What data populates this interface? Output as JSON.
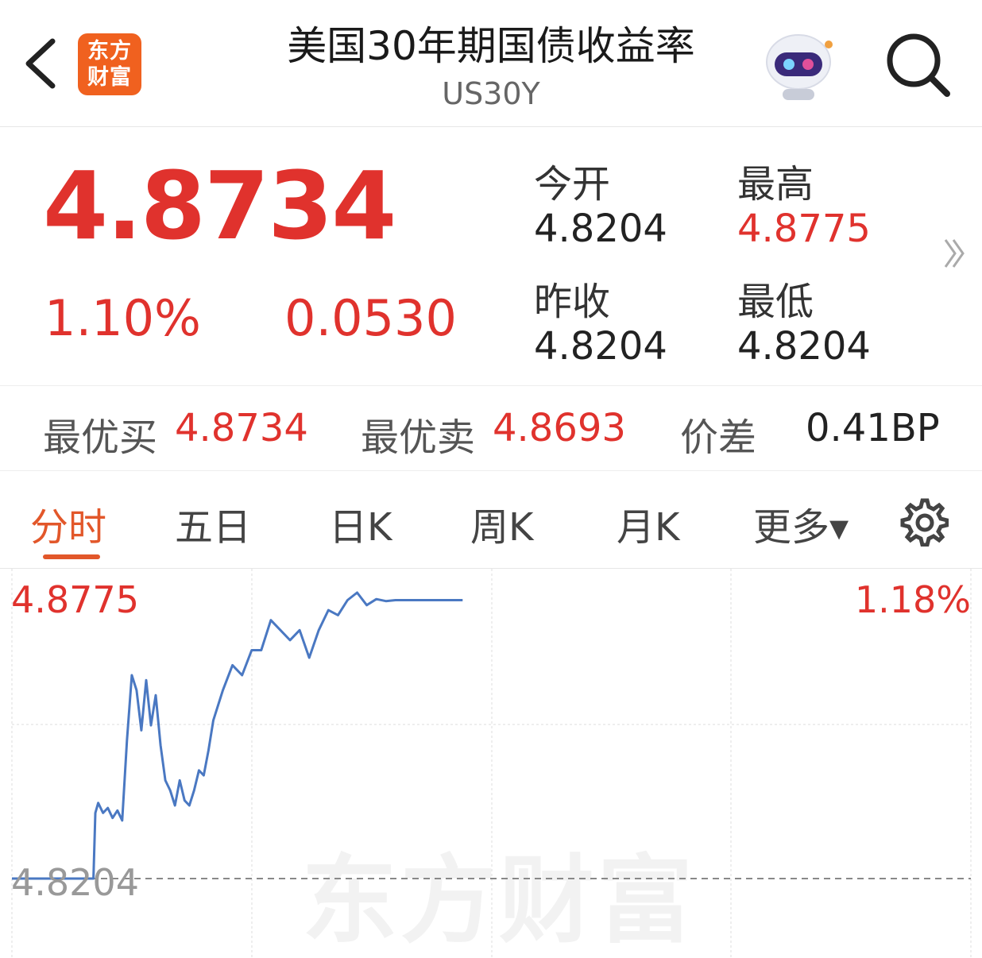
{
  "header": {
    "logo_line1": "东方",
    "logo_line2": "财富",
    "title": "美国30年期国债收益率",
    "subtitle": "US30Y",
    "icons": [
      "back-icon",
      "robot-avatar-icon",
      "search-icon"
    ]
  },
  "quote": {
    "price": "4.8734",
    "change_pct": "1.10%",
    "change": "0.0530",
    "open_label": "今开",
    "open_value": "4.8204",
    "high_label": "最高",
    "high_value": "4.8775",
    "prev_close_label": "昨收",
    "prev_close_value": "4.8204",
    "low_label": "最低",
    "low_value": "4.8204",
    "more_icon": "double-chevron-right-icon"
  },
  "bidask": {
    "bid_label": "最优买",
    "bid_value": "4.8734",
    "ask_label": "最优卖",
    "ask_value": "4.8693",
    "spread_label": "价差",
    "spread_value": "0.41BP"
  },
  "tabs": {
    "items": [
      "分时",
      "五日",
      "日K",
      "周K",
      "月K",
      "更多▾"
    ],
    "active": "分时",
    "settings_icon": "gear-icon"
  },
  "colors": {
    "up": "#e0322d",
    "accent": "#e2572a",
    "line": "#4a78c2"
  },
  "chart_data": {
    "type": "line",
    "top_left_label": "4.8775",
    "top_right_label": "1.18%",
    "base_label": "4.8204",
    "watermark": "东方财富",
    "y_range": [
      4.8204,
      4.8775
    ],
    "x_domain": [
      0,
      100
    ],
    "base_value": 4.8204,
    "grid": true,
    "series": [
      {
        "x": [
          0,
          3,
          8.5,
          8.7,
          9,
          9.5,
          10,
          10.5,
          11,
          11.5,
          12,
          12.5,
          13,
          13.5,
          14,
          14.5,
          15,
          15.5,
          16,
          16.5,
          17,
          17.5,
          18,
          18.5,
          19,
          19.5,
          20,
          20.5,
          21,
          22,
          23,
          24,
          25,
          26,
          27,
          28,
          29,
          30,
          31,
          32,
          33,
          34,
          35,
          36,
          37,
          38,
          39,
          40,
          41,
          42,
          43,
          44,
          45,
          46,
          47
        ],
        "y": [
          4.8204,
          4.8204,
          4.8204,
          4.8335,
          4.8355,
          4.8335,
          4.8345,
          4.8325,
          4.834,
          4.832,
          4.848,
          4.861,
          4.858,
          4.85,
          4.86,
          4.851,
          4.857,
          4.847,
          4.84,
          4.838,
          4.835,
          4.84,
          4.836,
          4.835,
          4.838,
          4.842,
          4.841,
          4.846,
          4.852,
          4.858,
          4.863,
          4.861,
          4.866,
          4.866,
          4.872,
          4.87,
          4.868,
          4.87,
          4.8645,
          4.87,
          4.874,
          4.873,
          4.876,
          4.8775,
          4.875,
          4.8762,
          4.8758,
          4.876,
          4.876,
          4.876,
          4.876,
          4.876,
          4.876,
          4.876,
          4.876
        ]
      }
    ]
  }
}
